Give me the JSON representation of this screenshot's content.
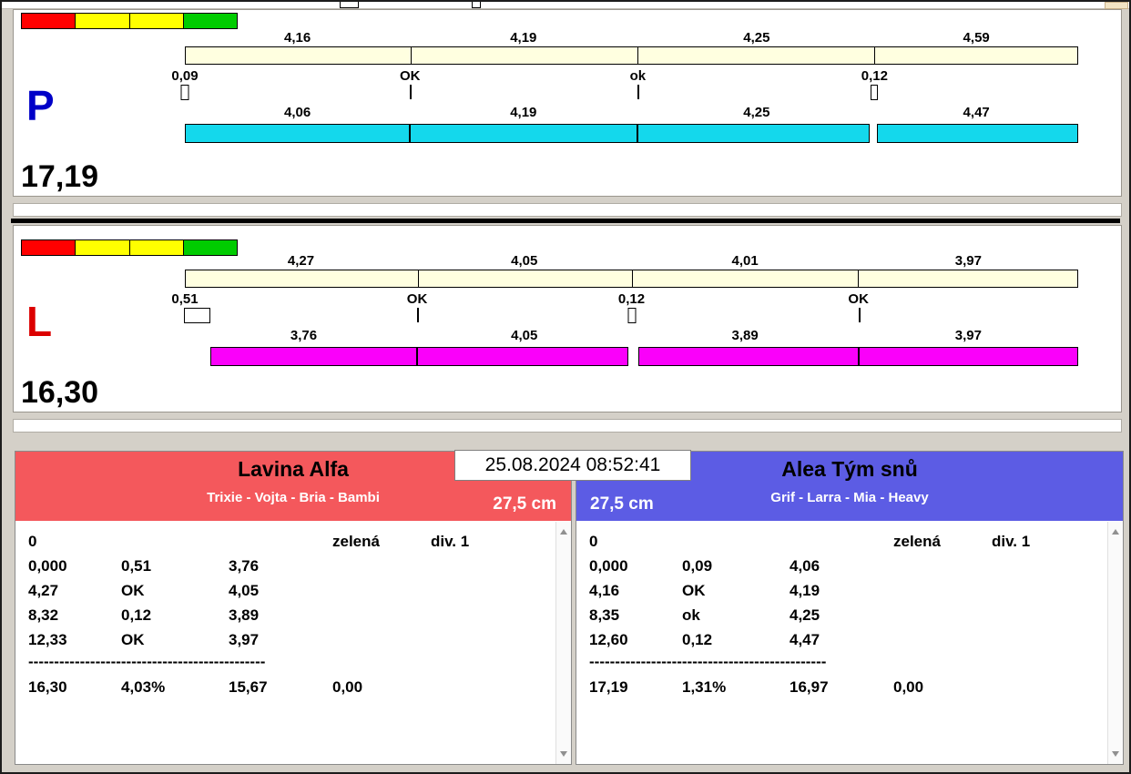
{
  "datetime": "25.08.2024 08:52:41",
  "colors": {
    "lane_p_bar": "#14d8ec",
    "lane_l_bar": "#fa00fa",
    "split_bar": "#ffffe0",
    "team_left_header": "#f4585c",
    "team_right_header": "#5c5ce4",
    "lane_p_letter": "#0000c8",
    "lane_l_letter": "#dc0000"
  },
  "lanes": {
    "p": {
      "letter": "P",
      "total": "17,19",
      "top_segments": [
        "4,16",
        "4,19",
        "4,25",
        "4,59"
      ],
      "markers": [
        "0,09",
        "OK",
        "ok",
        "0,12"
      ],
      "bottom_segments": [
        "4,06",
        "4,19",
        "4,25",
        "4,47"
      ]
    },
    "l": {
      "letter": "L",
      "total": "16,30",
      "top_segments": [
        "4,27",
        "4,05",
        "4,01",
        "3,97"
      ],
      "markers": [
        "0,51",
        "OK",
        "0,12",
        "OK"
      ],
      "bottom_segments": [
        "3,76",
        "4,05",
        "3,89",
        "3,97"
      ]
    }
  },
  "teams": {
    "left": {
      "name": "Lavina Alfa",
      "roster": "Trixie - Vojta - Bria - Bambi",
      "jump_height": "27,5 cm",
      "info_row": {
        "c1": "0",
        "c4": "zelená",
        "c5": "div. 1"
      },
      "rows": [
        {
          "c1": "0,000",
          "c2": "0,51",
          "c3": "3,76"
        },
        {
          "c1": "4,27",
          "c2": "OK",
          "c3": "4,05"
        },
        {
          "c1": "8,32",
          "c2": "0,12",
          "c3": "3,89"
        },
        {
          "c1": "12,33",
          "c2": "OK",
          "c3": "3,97"
        }
      ],
      "separator": "----------------------------------------------",
      "total_row": {
        "c1": "16,30",
        "c2": "4,03%",
        "c3": "15,67",
        "c4": "0,00"
      }
    },
    "right": {
      "name": "Alea Tým snů",
      "roster": "Grif - Larra - Mia - Heavy",
      "jump_height": "27,5 cm",
      "info_row": {
        "c1": "0",
        "c4": "zelená",
        "c5": "div. 1"
      },
      "rows": [
        {
          "c1": "0,000",
          "c2": "0,09",
          "c3": "4,06"
        },
        {
          "c1": "4,16",
          "c2": "OK",
          "c3": "4,19"
        },
        {
          "c1": "8,35",
          "c2": "ok",
          "c3": "4,25"
        },
        {
          "c1": "12,60",
          "c2": "0,12",
          "c3": "4,47"
        }
      ],
      "separator": "----------------------------------------------",
      "total_row": {
        "c1": "17,19",
        "c2": "1,31%",
        "c3": "16,97",
        "c4": "0,00"
      }
    }
  }
}
